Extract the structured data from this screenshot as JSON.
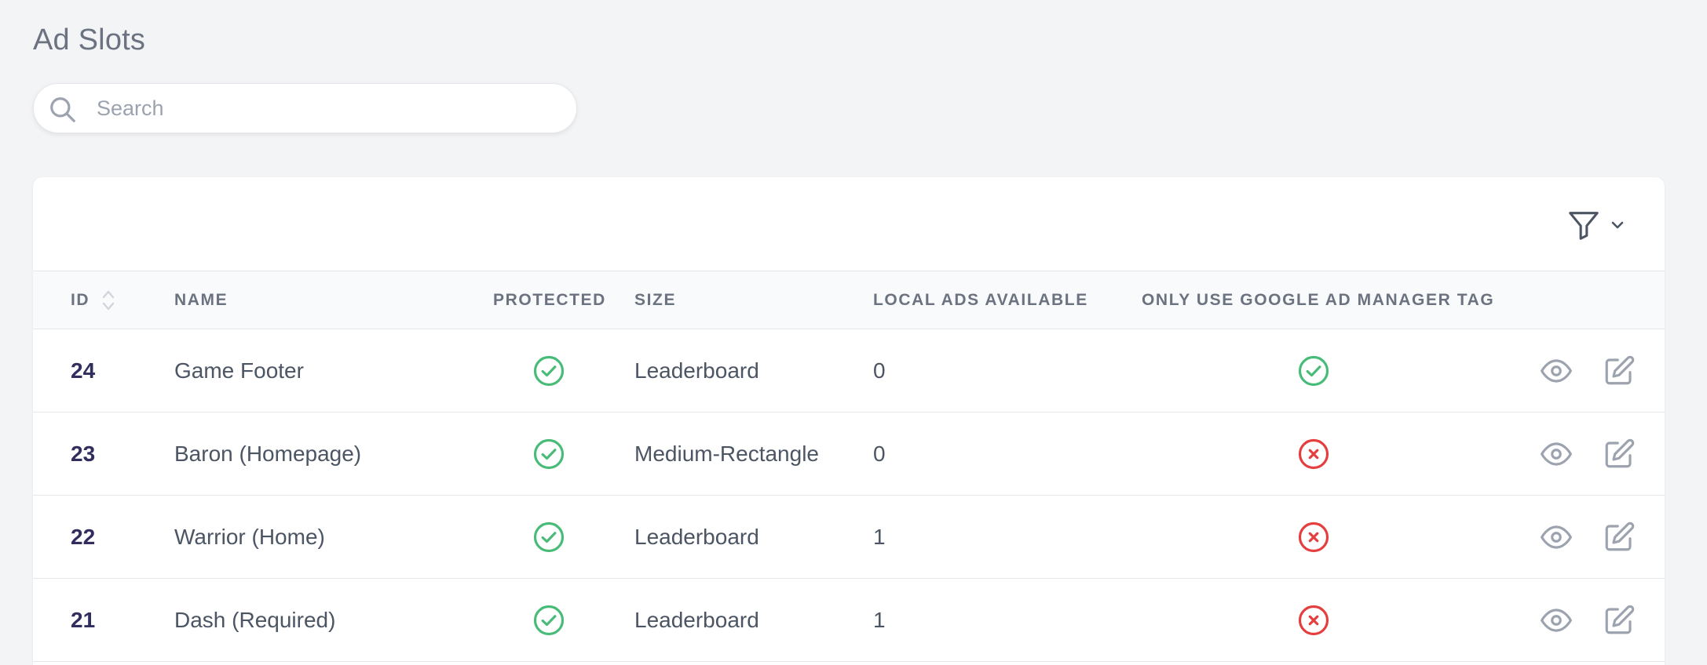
{
  "page": {
    "title": "Ad Slots"
  },
  "search": {
    "placeholder": "Search",
    "value": "",
    "icon": "search-icon"
  },
  "toolbar": {
    "filter_icon": "filter-icon",
    "dropdown_icon": "chevron-down-icon"
  },
  "table": {
    "columns": [
      "ID",
      "NAME",
      "PROTECTED",
      "SIZE",
      "LOCAL ADS AVAILABLE",
      "ONLY USE GOOGLE AD MANAGER TAG"
    ],
    "rows": [
      {
        "id": "24",
        "name": "Game Footer",
        "protected": true,
        "size": "Leaderboard",
        "local_ads": "0",
        "only_gam": true
      },
      {
        "id": "23",
        "name": "Baron (Homepage)",
        "protected": true,
        "size": "Medium-Rectangle",
        "local_ads": "0",
        "only_gam": false
      },
      {
        "id": "22",
        "name": "Warrior (Home)",
        "protected": true,
        "size": "Leaderboard",
        "local_ads": "1",
        "only_gam": false
      },
      {
        "id": "21",
        "name": "Dash (Required)",
        "protected": true,
        "size": "Leaderboard",
        "local_ads": "1",
        "only_gam": false
      }
    ]
  },
  "colors": {
    "check": "#48bb78",
    "cross": "#e53e3e",
    "action": "#9ca3af"
  }
}
